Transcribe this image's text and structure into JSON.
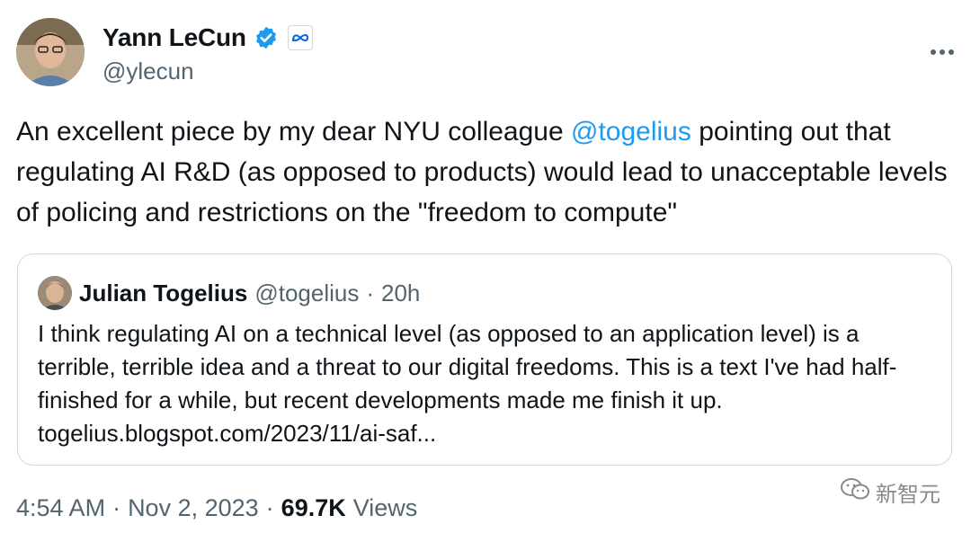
{
  "author": {
    "display_name": "Yann LeCun",
    "handle": "@ylecun"
  },
  "tweet": {
    "text_before": "An excellent piece by my dear NYU colleague ",
    "mention": "@togelius",
    "text_after": " pointing out that regulating AI R&D (as opposed to products) would lead to unacceptable levels of policing and restrictions on the \"freedom to compute\""
  },
  "quote": {
    "display_name": "Julian Togelius",
    "handle": "@togelius",
    "separator": "·",
    "time": "20h",
    "text": "I think regulating AI on a technical level (as opposed to an application level) is a terrible, terrible idea and a threat to our digital freedoms. This is a text I've had half-finished for a while, but recent developments made me finish it up. togelius.blogspot.com/2023/11/ai-saf..."
  },
  "footer": {
    "time": "4:54 AM",
    "sep1": "·",
    "date": "Nov 2, 2023",
    "sep2": "·",
    "views_count": "69.7K",
    "views_label": "Views"
  },
  "watermark": {
    "text": "新智元"
  },
  "icons": {
    "verified": "verified-badge-icon",
    "affiliate": "meta-logo-icon",
    "more": "more-options-icon"
  },
  "colors": {
    "accent": "#1d9bf0",
    "secondary_text": "#536471",
    "primary_text": "#0f1419",
    "border": "#cfd9de"
  }
}
